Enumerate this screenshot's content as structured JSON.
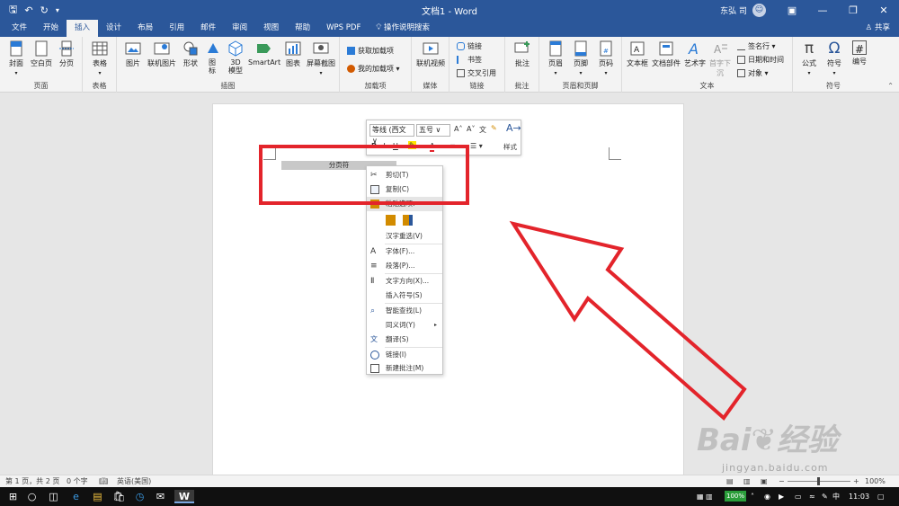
{
  "titlebar": {
    "doc_title": "文档1 - Word",
    "user_name": "东弘 司",
    "qat_icons": [
      "save-icon",
      "undo-icon",
      "redo-icon",
      "customize-icon"
    ]
  },
  "tabs": {
    "items": [
      "文件",
      "开始",
      "插入",
      "设计",
      "布局",
      "引用",
      "邮件",
      "审阅",
      "视图",
      "帮助",
      "WPS PDF"
    ],
    "active": "插入",
    "tell_me": "操作说明搜索",
    "share": "共享"
  },
  "ribbon": {
    "pages_group": {
      "label": "页面",
      "cover": "封面",
      "blank": "空白页",
      "break": "分页"
    },
    "table_group": {
      "label": "表格",
      "table": "表格"
    },
    "illustrations_group": {
      "label": "插图",
      "picture": "图片",
      "online_picture": "联机图片",
      "shapes": "形状",
      "icons": "图\n标",
      "model3d": "3D\n模型",
      "smartart": "SmartArt",
      "chart": "图表",
      "screenshot": "屏幕截图"
    },
    "addins_group": {
      "label": "加载项",
      "get_addins": "获取加载项",
      "my_addins": "我的加载项"
    },
    "media_group": {
      "label": "媒体",
      "online_video": "联机视频"
    },
    "links_group": {
      "label": "链接",
      "link": "链接",
      "bookmark": "书签",
      "cross_ref": "交叉引用"
    },
    "comments_group": {
      "label": "批注",
      "comment": "批注"
    },
    "header_footer_group": {
      "label": "页眉和页脚",
      "header": "页眉",
      "footer": "页脚",
      "page_number": "页码"
    },
    "text_group": {
      "label": "文本",
      "textbox": "文本框",
      "quickparts": "文档部件",
      "wordart": "艺术字",
      "dropcap": "首字下沉",
      "signature": "签名行",
      "datetime": "日期和时间",
      "object": "对象"
    },
    "symbols_group": {
      "label": "符号",
      "equation": "公式",
      "symbol": "符号",
      "numbering": "编号"
    }
  },
  "document": {
    "page_break_label": "分页符",
    "page_break_mark": "¶"
  },
  "mini_toolbar": {
    "font_name": "等线 (西文",
    "font_size": "五号",
    "styles_label": "样式"
  },
  "context_menu": {
    "items": [
      {
        "label": "剪切(T)",
        "icon": "scissors-icon"
      },
      {
        "label": "复制(C)",
        "icon": "copy-icon"
      },
      {
        "label": "粘贴选项:",
        "icon": "paste-icon"
      },
      {
        "label": "",
        "icon": "paste-options-icon"
      },
      {
        "label": "汉字重选(V)",
        "icon": ""
      },
      {
        "label": "字体(F)...",
        "icon": "font-icon"
      },
      {
        "label": "段落(P)...",
        "icon": "paragraph-icon"
      },
      {
        "label": "文字方向(X)...",
        "icon": "text-direction-icon"
      },
      {
        "label": "插入符号(S)",
        "icon": ""
      },
      {
        "label": "智能查找(L)",
        "icon": "search-icon"
      },
      {
        "label": "同义词(Y)",
        "icon": ""
      },
      {
        "label": "翻译(S)",
        "icon": "translate-icon"
      },
      {
        "label": "链接(I)",
        "icon": "link-icon"
      },
      {
        "label": "新建批注(M)",
        "icon": "comment-icon"
      }
    ]
  },
  "status_bar": {
    "page_info": "第 1 页，共 2 页",
    "word_count": "0 个字",
    "language": "英语(美国)",
    "zoom": "100%"
  },
  "taskbar": {
    "battery": "100%",
    "ime": "中",
    "time": "11:03"
  },
  "watermark": {
    "brand": "Bai",
    "brand_suffix": "经验",
    "url": "jingyan.baidu.com"
  },
  "colors": {
    "accent": "#2b579a",
    "highlight": "#e3242b",
    "ribbon_bg": "#f3f3f3"
  }
}
